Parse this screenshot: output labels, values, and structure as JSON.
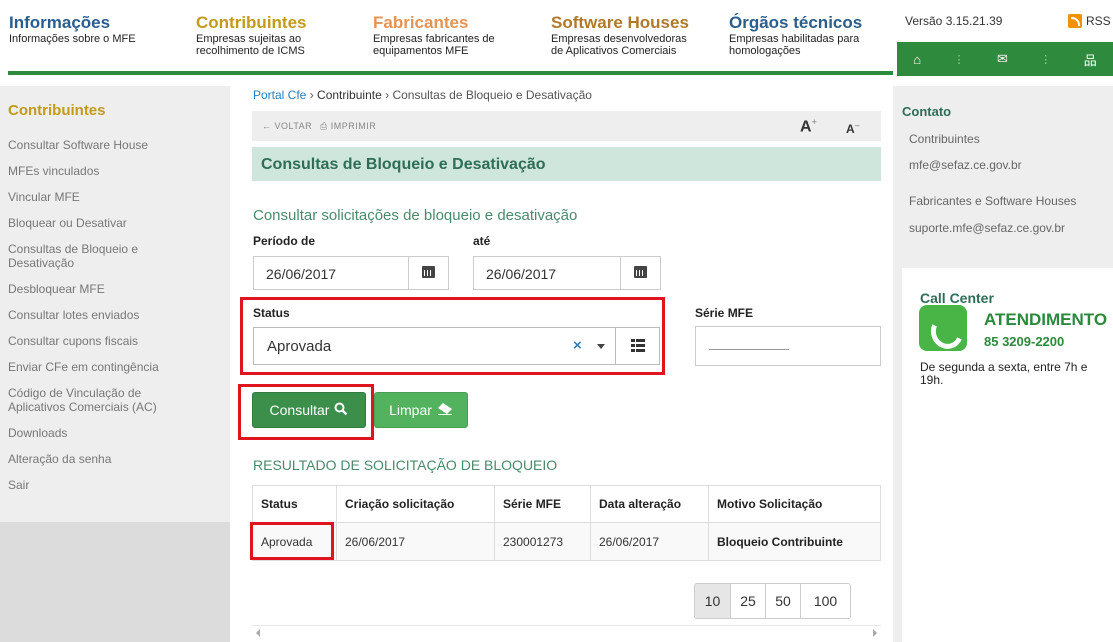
{
  "header": {
    "nav": [
      {
        "title": "Informações",
        "sub": "Informações sobre o MFE"
      },
      {
        "title": "Contribuintes",
        "sub": "Empresas sujeitas ao recolhimento de ICMS"
      },
      {
        "title": "Fabricantes",
        "sub": "Empresas fabricantes de equipamentos MFE"
      },
      {
        "title": "Software Houses",
        "sub": "Empresas desenvolvedoras de Aplicativos Comerciais"
      },
      {
        "title": "Órgãos técnicos",
        "sub": "Empresas habilitadas para homologações"
      }
    ],
    "version": "Versão 3.15.21.39",
    "rss": "RSS",
    "icons": {
      "home": "⌂",
      "mail": "✉",
      "sitemap": "品"
    }
  },
  "sidebar": {
    "title": "Contribuintes",
    "items": [
      "Consultar Software House",
      "MFEs vinculados",
      "Vincular MFE",
      "Bloquear ou Desativar",
      "Consultas de Bloqueio e Desativação",
      "Desbloquear MFE",
      "Consultar lotes enviados",
      "Consultar cupons fiscais",
      "Enviar CFe em contingência",
      "Código de Vinculação de Aplicativos Comerciais (AC)",
      "Downloads",
      "Alteração da senha",
      "Sair"
    ]
  },
  "breadcrumb": {
    "home": "Portal Cfe",
    "sep": "›",
    "section": "Contribuinte",
    "current": "Consultas de Bloqueio e Desativação"
  },
  "toolbar": {
    "back": "← VOLTAR",
    "print": "⎙ IMPRIMIR",
    "font_up": "A",
    "font_down": "A",
    "plus": "+",
    "minus": "–"
  },
  "page_title": "Consultas de Bloqueio e Desativação",
  "form": {
    "subtitle": "Consultar solicitações de bloqueio e desativação",
    "from_label": "Período de",
    "to_label": "até",
    "from_value": "26/06/2017",
    "to_value": "26/06/2017",
    "status_label": "Status",
    "status_value": "Aprovada",
    "serie_label": "Série MFE",
    "clear_symbol": "×",
    "search_button": "Consultar",
    "clear_button": "Limpar"
  },
  "results": {
    "title": "RESULTADO DE SOLICITAÇÃO DE BLOQUEIO",
    "columns": [
      "Status",
      "Criação solicitação",
      "Série MFE",
      "Data alteração",
      "Motivo Solicitação"
    ],
    "rows": [
      [
        "Aprovada",
        "26/06/2017",
        "230001273",
        "26/06/2017",
        "Bloqueio Contribuinte"
      ]
    ],
    "page_sizes": [
      "10",
      "25",
      "50",
      "100"
    ]
  },
  "contact": {
    "title": "Contato",
    "contrib_label": "Contribuintes",
    "contrib_email": "mfe@sefaz.ce.gov.br",
    "fab_label": "Fabricantes e Software Houses",
    "fab_email": "suporte.mfe@sefaz.ce.gov.br",
    "call_title": "Call Center",
    "atendimento": "ATENDIMENTO",
    "phone": "85 3209-2200",
    "hours": "De segunda a sexta, entre 7h e 19h."
  },
  "colors": {
    "green": "#2e8b3e",
    "highlight_red": "#e0141e",
    "gold": "#c39a1c",
    "link_blue": "#2a7fba"
  }
}
